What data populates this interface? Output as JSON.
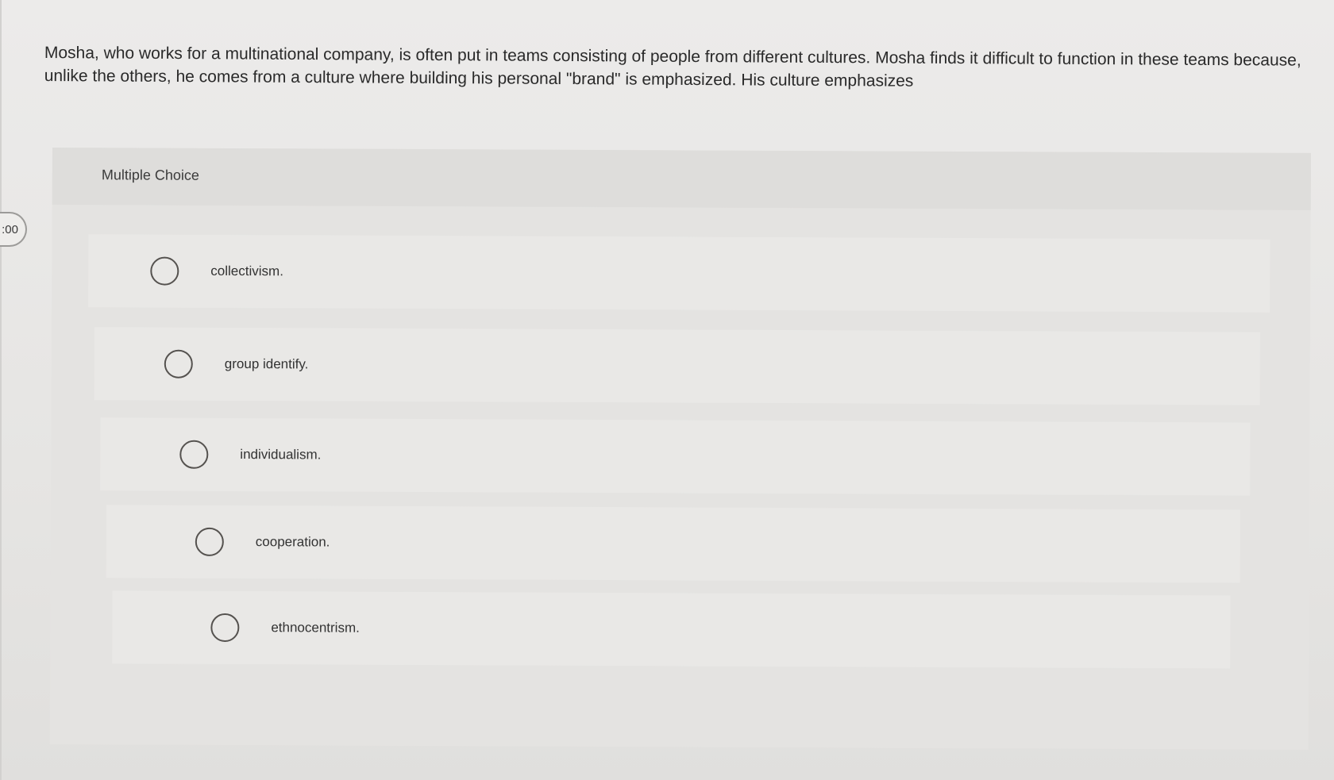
{
  "badge": {
    "text": ":00"
  },
  "question": {
    "text": "Mosha, who works for a multinational company, is often put in teams consisting of people from different cultures. Mosha finds it difficult to function in these teams because, unlike the others, he comes from a culture where building his personal \"brand\" is emphasized. His culture emphasizes"
  },
  "choice_panel": {
    "title": "Multiple Choice",
    "options": [
      {
        "label": "collectivism."
      },
      {
        "label": "group identify."
      },
      {
        "label": "individualism."
      },
      {
        "label": "cooperation."
      },
      {
        "label": "ethnocentrism."
      }
    ]
  }
}
